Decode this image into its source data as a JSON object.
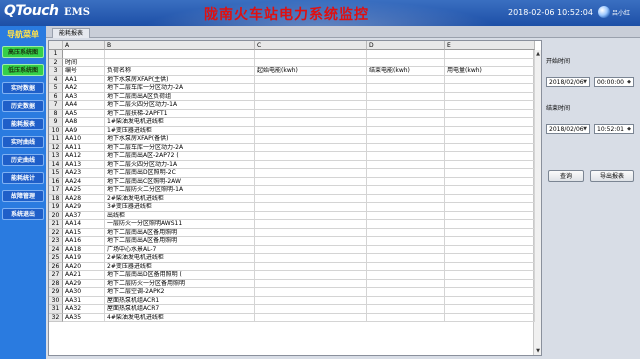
{
  "header": {
    "logo": "QTouch",
    "logo_sub": "EMS",
    "title": "陇南火车站电力系统监控",
    "datetime": "2018-02-06 10:52:04",
    "user": "吕小红"
  },
  "nav": {
    "title": "导航菜单",
    "items": [
      {
        "label": "高压系统图",
        "active": true
      },
      {
        "label": "低压系统图",
        "active": true
      },
      {
        "label": "实时数据",
        "active": false
      },
      {
        "label": "历史数据",
        "active": false
      },
      {
        "label": "能耗报表",
        "active": false
      },
      {
        "label": "实时曲线",
        "active": false
      },
      {
        "label": "历史曲线",
        "active": false
      },
      {
        "label": "能耗统计",
        "active": false
      },
      {
        "label": "故障管理",
        "active": false
      },
      {
        "label": "系统退出",
        "active": false
      }
    ]
  },
  "tab": {
    "label": "能耗报表"
  },
  "sheet": {
    "columns": [
      "A",
      "B",
      "C",
      "D",
      "E"
    ],
    "rows": [
      [
        "",
        "",
        "",
        "",
        ""
      ],
      [
        "时间",
        "",
        "",
        "",
        ""
      ],
      [
        "编号",
        "负荷名称",
        "起始电能(kwh)",
        "结束电能(kwh)",
        "用电量(kwh)"
      ],
      [
        "AA1",
        "地下水泵房XFAP(主供)",
        "",
        "",
        ""
      ],
      [
        "AA2",
        "地下二层车库一分区动力-2A",
        "",
        "",
        ""
      ],
      [
        "AA3",
        "地下二层南出A区负荷组",
        "",
        "",
        ""
      ],
      [
        "AA4",
        "地下二层火四分区动力-1A",
        "",
        "",
        ""
      ],
      [
        "AA5",
        "地下二层扶梯-2APFT1",
        "",
        "",
        ""
      ],
      [
        "AA8",
        "1#柴油发电机进线柜",
        "",
        "",
        ""
      ],
      [
        "AA9",
        "1#变压器进线柜",
        "",
        "",
        ""
      ],
      [
        "AA10",
        "地下水泵房XFAP(备供)",
        "",
        "",
        ""
      ],
      [
        "AA11",
        "地下二层车库一分区动力-2A",
        "",
        "",
        ""
      ],
      [
        "AA12",
        "地下二层南出A区-2AP72 (",
        "",
        "",
        ""
      ],
      [
        "AA13",
        "地下二层火四分区动力-1A",
        "",
        "",
        ""
      ],
      [
        "AA23",
        "地下二层南出D区照明-2C",
        "",
        "",
        ""
      ],
      [
        "AA24",
        "地下二层南出C区照明-2AW",
        "",
        "",
        ""
      ],
      [
        "AA25",
        "地下二层防火二分区照明-1A",
        "",
        "",
        ""
      ],
      [
        "AA28",
        "2#柴油发电机进线柜",
        "",
        "",
        ""
      ],
      [
        "AA29",
        "3#变压器进线柜",
        "",
        "",
        ""
      ],
      [
        "AA37",
        "出线柜",
        "",
        "",
        ""
      ],
      [
        "AA14",
        "一层防火一分区照明AWS11",
        "",
        "",
        ""
      ],
      [
        "AA15",
        "地下二层南出A区备用照明",
        "",
        "",
        ""
      ],
      [
        "AA16",
        "地下二层南出A区备用照明",
        "",
        "",
        ""
      ],
      [
        "AA18",
        "广场中心水景AL-7",
        "",
        "",
        ""
      ],
      [
        "AA19",
        "2#柴油发电机进线柜",
        "",
        "",
        ""
      ],
      [
        "AA20",
        "2#变压器进线柜",
        "",
        "",
        ""
      ],
      [
        "AA21",
        "地下二层南出D区备用照明 (",
        "",
        "",
        ""
      ],
      [
        "AA29",
        "地下二层防火一分区备用照明",
        "",
        "",
        ""
      ],
      [
        "AA30",
        "地下二层空调-2APK2",
        "",
        "",
        ""
      ],
      [
        "AA31",
        "屋面热泵机组ACR1",
        "",
        "",
        ""
      ],
      [
        "AA32",
        "屋面热泵机组ACR7",
        "",
        "",
        ""
      ],
      [
        "AA35",
        "4#柴油发电机进线柜",
        "",
        "",
        ""
      ]
    ]
  },
  "panel": {
    "start_label": "开始时间",
    "start_date": "2018/02/06",
    "start_time": "00:00:00",
    "end_label": "结束时间",
    "end_date": "2018/02/06",
    "end_time": "10:52:01",
    "query_label": "查询",
    "export_label": "导出报表"
  },
  "colors": {
    "header_bg": "#1d4fa6",
    "title_red": "#e01010",
    "nav_bg": "#2a7be0",
    "nav_active": "#35d04a",
    "nav_title": "#ffe14a"
  }
}
